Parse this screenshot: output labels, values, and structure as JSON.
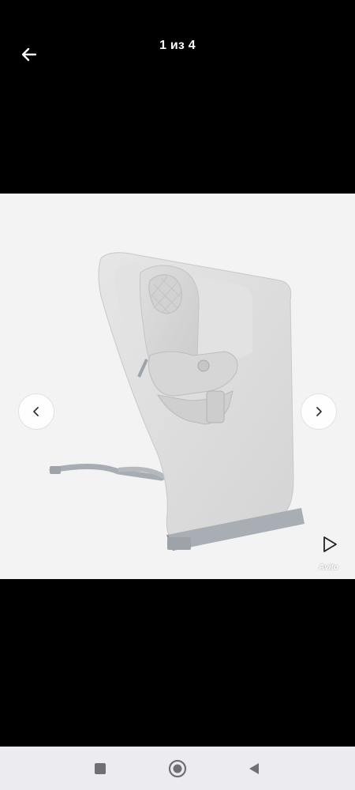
{
  "header": {
    "counter": "1 из 4",
    "back_icon": "arrow-left-icon"
  },
  "gallery": {
    "prev_icon": "chevron-left-icon",
    "next_icon": "chevron-right-icon",
    "play_icon": "play-icon",
    "watermark": "Avito",
    "background_color": "#f3f3f3",
    "product_color": "#dcdcdc"
  },
  "system_nav": {
    "recents_icon": "square-icon",
    "home_icon": "circle-icon",
    "back_icon": "triangle-back-icon"
  }
}
